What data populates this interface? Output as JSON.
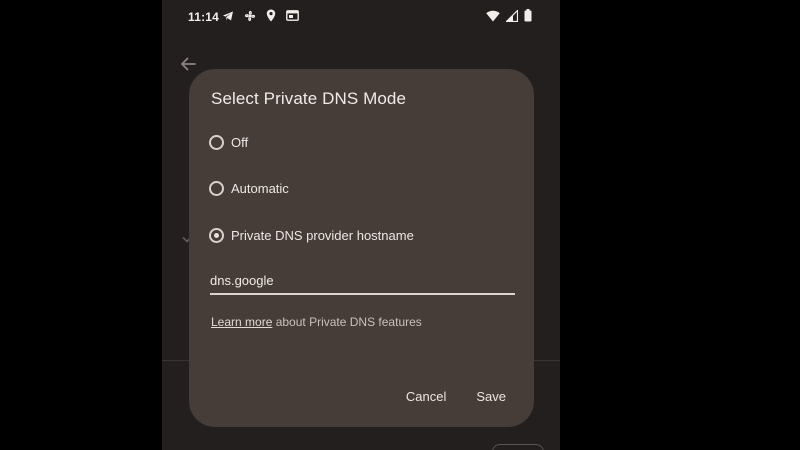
{
  "status_bar": {
    "time": "11:14",
    "left_icons": [
      "telegram-icon",
      "fan-icon",
      "location-icon",
      "window-icon"
    ],
    "right_icons": [
      "wifi-icon",
      "cellular-signal-icon",
      "battery-icon"
    ]
  },
  "background": {
    "back_icon": "back-arrow-icon"
  },
  "dialog": {
    "title": "Select Private DNS Mode",
    "options": [
      {
        "label": "Off",
        "selected": false
      },
      {
        "label": "Automatic",
        "selected": false
      },
      {
        "label": "Private DNS provider hostname",
        "selected": true
      }
    ],
    "hostname_value": "dns.google",
    "learn_more_link": "Learn more",
    "learn_more_rest": " about Private DNS features",
    "cancel_label": "Cancel",
    "save_label": "Save"
  },
  "colors": {
    "screen_bg": "#231f1e",
    "dialog_bg": "#463c38",
    "text": "#ece6e3"
  }
}
